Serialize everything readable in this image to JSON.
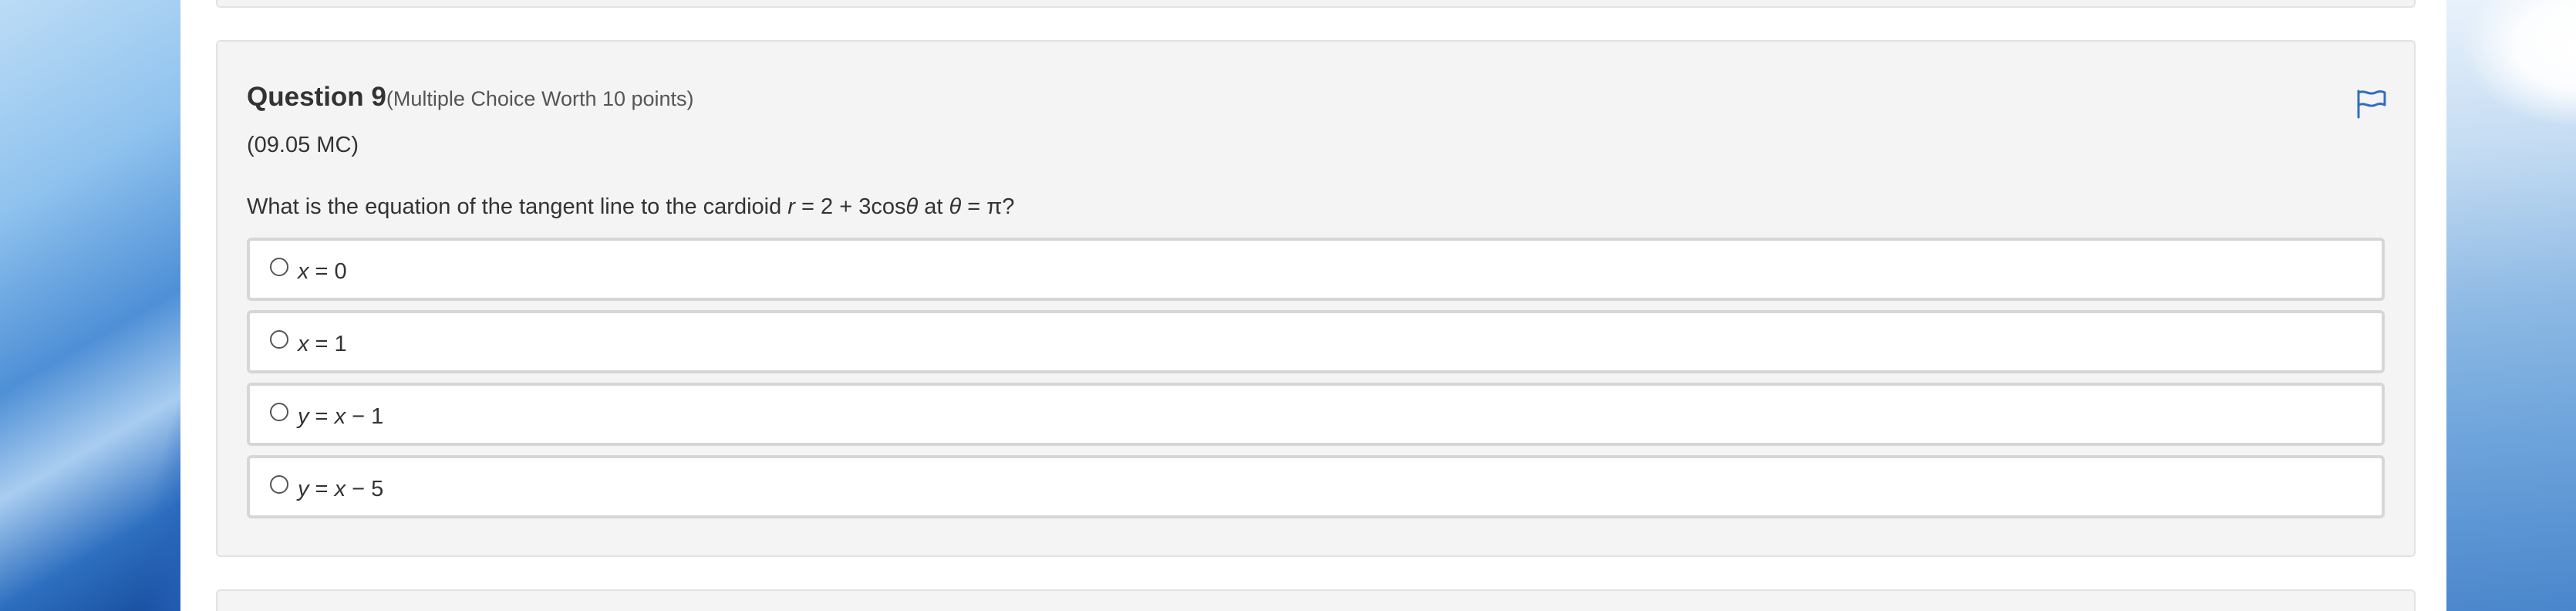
{
  "question": {
    "title": "Question 9",
    "subtitle": "(Multiple Choice Worth 10 points)",
    "code": "(09.05 MC)",
    "text_before_r": "What is the equation of the tangent line to the cardioid ",
    "r_var": "r",
    "text_mid": " = 2 + 3cos",
    "theta_var_1": "θ",
    "text_at": " at ",
    "theta_var_2": "θ",
    "text_end": " = π?"
  },
  "flag_icon": "flag-icon",
  "options": [
    {
      "var": "x",
      "rest": " = 0"
    },
    {
      "var": "x",
      "rest": " = 1"
    },
    {
      "var": "y",
      "mid": " = ",
      "var2": "x",
      "rest": " − 1"
    },
    {
      "var": "y",
      "mid": " = ",
      "var2": "x",
      "rest": " − 5"
    }
  ],
  "colors": {
    "card_bg": "#f4f4f4",
    "option_border": "#d6d6d6",
    "flag_blue": "#2f6cc4",
    "text": "#333333"
  }
}
